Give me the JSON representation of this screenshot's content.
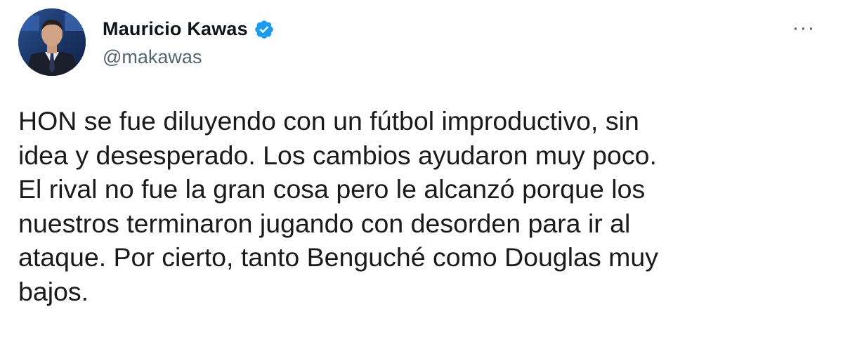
{
  "tweet": {
    "author": {
      "display_name": "Mauricio Kawas",
      "handle": "@makawas",
      "verified": true,
      "avatar_icon": "profile-photo"
    },
    "more_label": "···",
    "text": "HON se fue diluyendo con un fútbol improductivo, sin\nidea y desesperado. Los cambios ayudaron muy poco.\nEl rival no fue la gran cosa pero le alcanzó porque los\nnuestros terminaron jugando con desorden para ir al\nataque. Por cierto, tanto Benguché como Douglas muy\nbajos."
  },
  "colors": {
    "verified_blue": "#1d9bf0",
    "handle_gray": "#536471",
    "text_dark": "#0f1419"
  }
}
